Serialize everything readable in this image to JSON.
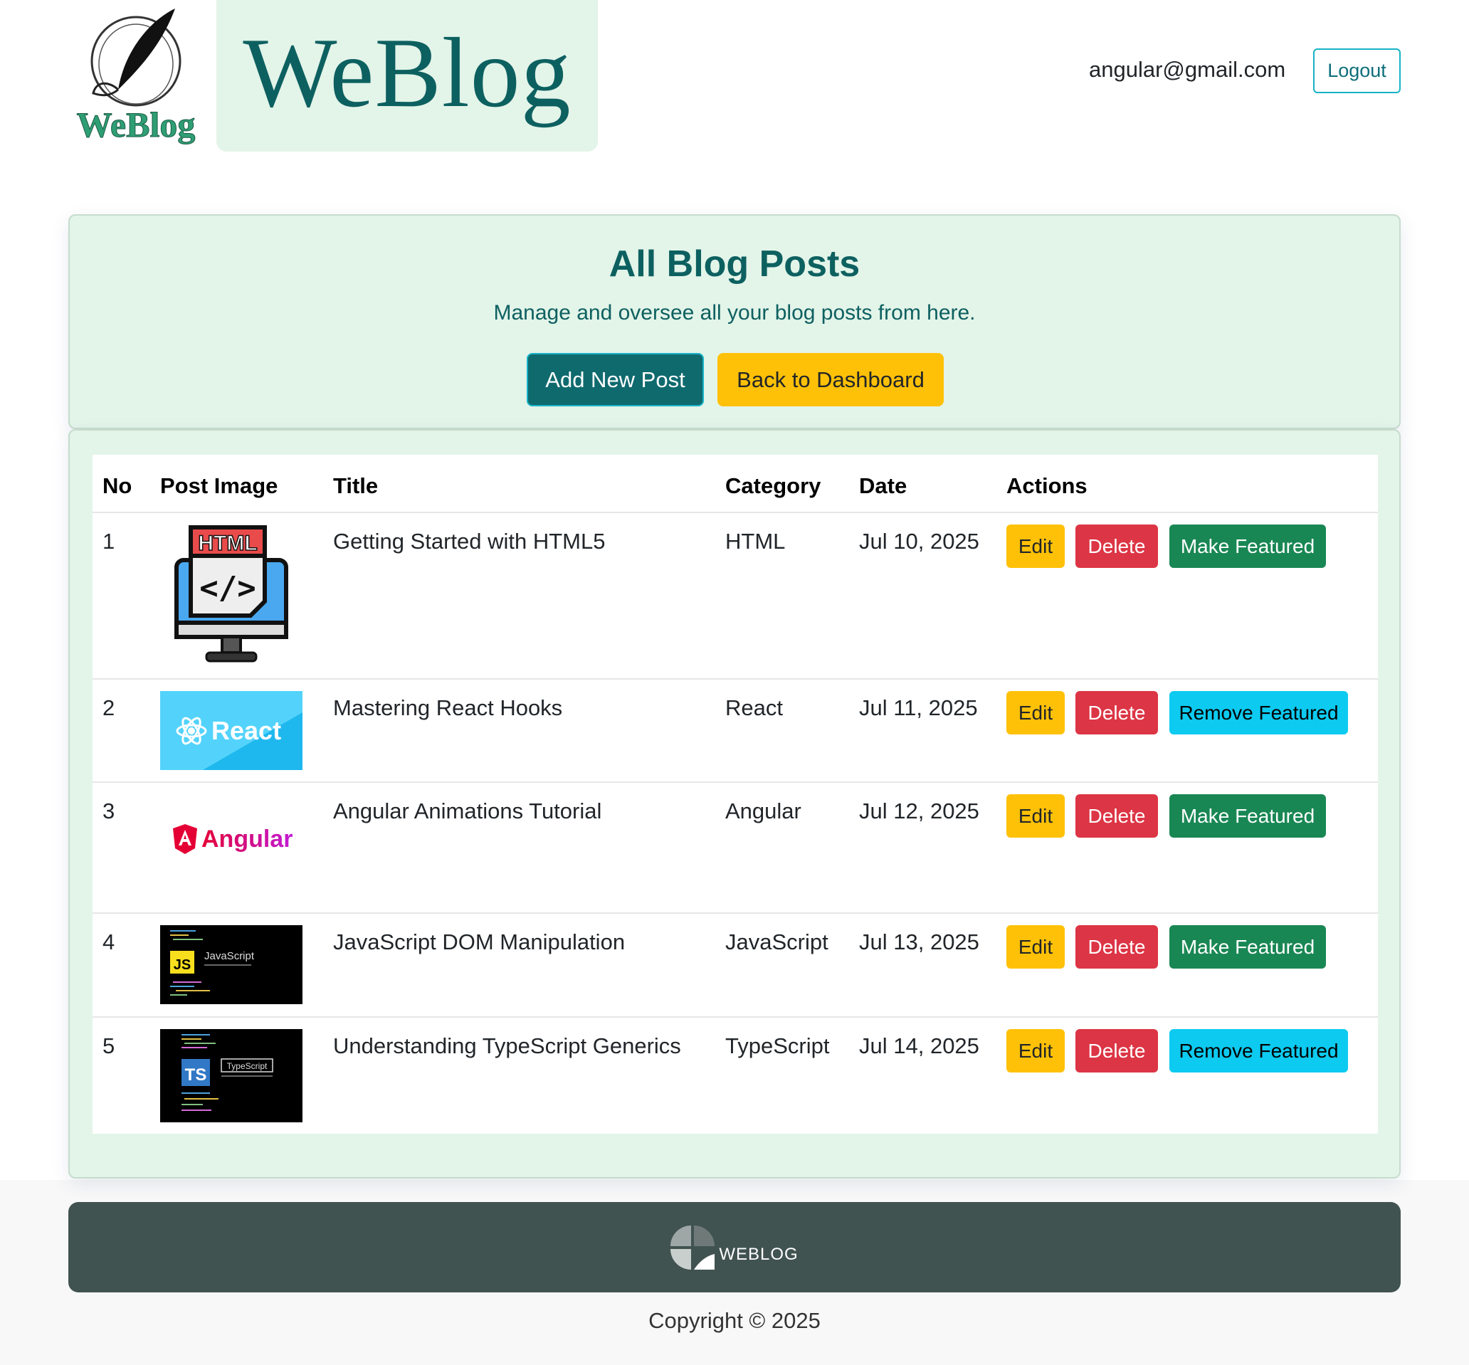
{
  "header": {
    "logo_text": "WeBlog",
    "brand_title": "WeBlog",
    "user_email": "angular@gmail.com",
    "logout_label": "Logout"
  },
  "hero": {
    "title": "All Blog Posts",
    "subtitle": "Manage and oversee all your blog posts from here.",
    "add_label": "Add New Post",
    "back_label": "Back to Dashboard"
  },
  "table": {
    "headers": [
      "No",
      "Post Image",
      "Title",
      "Category",
      "Date",
      "Actions"
    ],
    "edit_label": "Edit",
    "delete_label": "Delete",
    "rows": [
      {
        "no": "1",
        "image": "html-icon",
        "title": "Getting Started with HTML5",
        "category": "HTML",
        "date": "Jul 10, 2025",
        "featured_label": "Make Featured",
        "is_featured": false
      },
      {
        "no": "2",
        "image": "react-logo",
        "title": "Mastering React Hooks",
        "category": "React",
        "date": "Jul 11, 2025",
        "featured_label": "Remove Featured",
        "is_featured": true
      },
      {
        "no": "3",
        "image": "angular-logo",
        "title": "Angular Animations Tutorial",
        "category": "Angular",
        "date": "Jul 12, 2025",
        "featured_label": "Make Featured",
        "is_featured": false
      },
      {
        "no": "4",
        "image": "javascript-banner",
        "title": "JavaScript DOM Manipulation",
        "category": "JavaScript",
        "date": "Jul 13, 2025",
        "featured_label": "Make Featured",
        "is_featured": false
      },
      {
        "no": "5",
        "image": "typescript-banner",
        "title": "Understanding TypeScript Generics",
        "category": "TypeScript",
        "date": "Jul 14, 2025",
        "featured_label": "Remove Featured",
        "is_featured": true
      }
    ],
    "thumb_text": {
      "html": "HTML",
      "react": "React",
      "angular": "Angular",
      "js_badge": "JS",
      "js_name": "JavaScript",
      "ts_badge": "TS",
      "ts_name": "TypeScript"
    }
  },
  "footer": {
    "brand": "WEBLOG",
    "copyright": "Copyright © 2025"
  },
  "colors": {
    "brand_teal": "#0d6060",
    "hero_bg": "#e3f4e9",
    "edit": "#ffc107",
    "delete": "#dc3545",
    "make_featured": "#198754",
    "remove_featured": "#0dcaf0",
    "footer_bg": "#415350"
  }
}
